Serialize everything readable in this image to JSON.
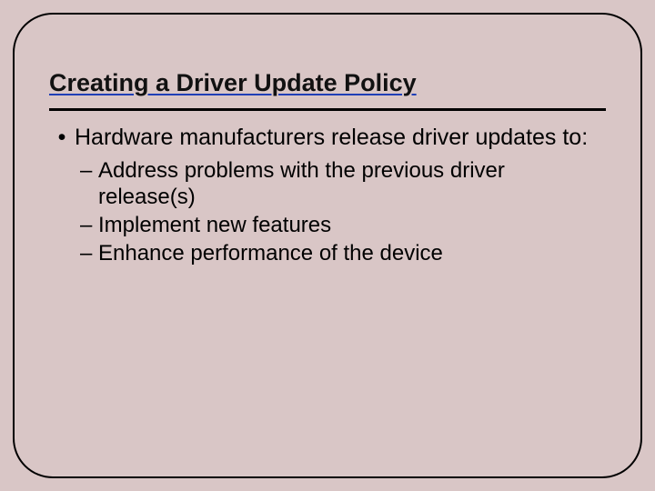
{
  "slide": {
    "title": "Creating a Driver Update Policy",
    "bullet1": "Hardware manufacturers release driver updates to:",
    "sub1": "Address problems with the previous driver release(s)",
    "sub2": "Implement new features",
    "sub3": "Enhance performance of the device"
  }
}
